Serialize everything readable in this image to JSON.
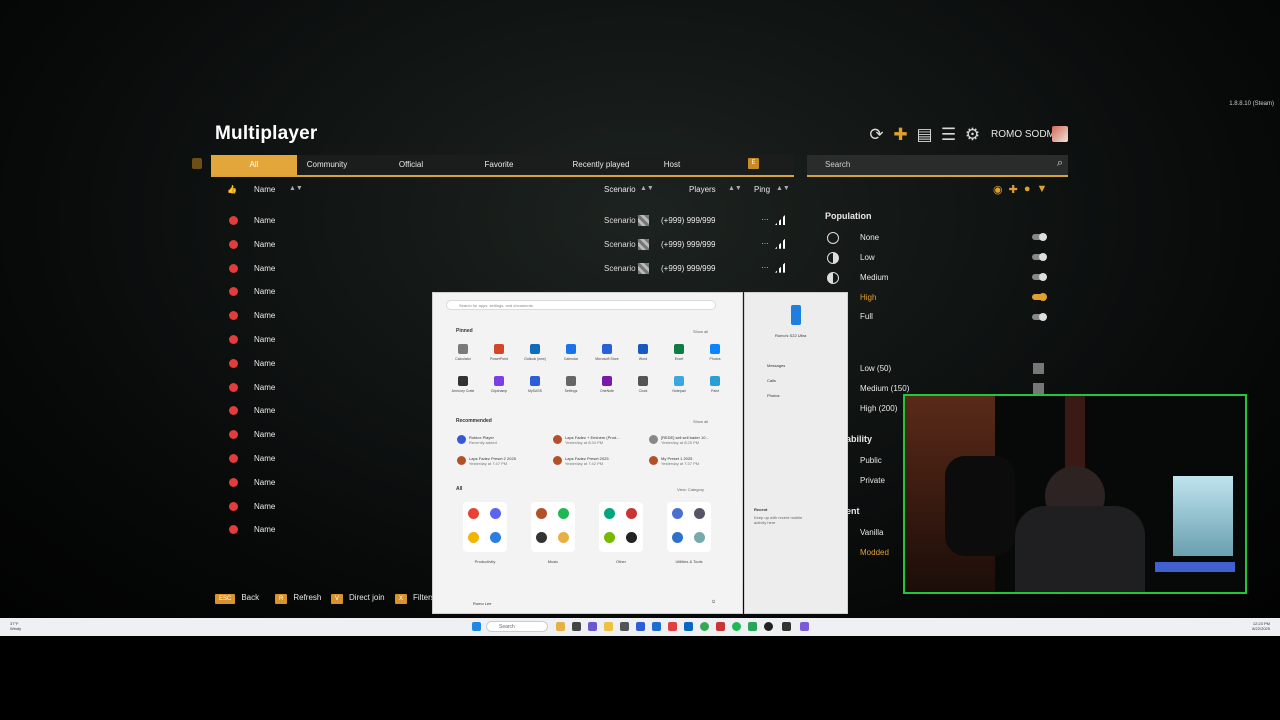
{
  "app": {
    "version": "1.8.8.10 (Steam)",
    "title": "Multiplayer",
    "username": "ROMO SODMG",
    "accent_color": "#e3a63b"
  },
  "tabs": [
    {
      "label": "All",
      "active": true
    },
    {
      "label": "Community"
    },
    {
      "label": "Official"
    },
    {
      "label": "Favorite"
    },
    {
      "label": "Recently played"
    },
    {
      "label": "Host"
    }
  ],
  "tab_extra_key": "E",
  "search": {
    "placeholder": "Search"
  },
  "columns": {
    "name": "Name",
    "scenario": "Scenario",
    "players": "Players",
    "ping": "Ping"
  },
  "servers": [
    {
      "name": "Name",
      "scenario": "Scenario",
      "players": "(+999) 999/999"
    },
    {
      "name": "Name",
      "scenario": "Scenario",
      "players": "(+999) 999/999"
    },
    {
      "name": "Name",
      "scenario": "Scenario",
      "players": "(+999) 999/999"
    },
    {
      "name": "Name"
    },
    {
      "name": "Name"
    },
    {
      "name": "Name"
    },
    {
      "name": "Name"
    },
    {
      "name": "Name"
    },
    {
      "name": "Name"
    },
    {
      "name": "Name"
    },
    {
      "name": "Name"
    },
    {
      "name": "Name"
    },
    {
      "name": "Name"
    },
    {
      "name": "Name"
    }
  ],
  "filters": {
    "population_header": "Population",
    "population": [
      "None",
      "Low",
      "Medium",
      "High",
      "Full"
    ],
    "high_selected": true,
    "capacity": [
      "Low (50)",
      "Medium (150)",
      "High (200)"
    ],
    "availability_header": "ability",
    "availability": [
      "Public",
      "Private"
    ],
    "content_header": "ent",
    "content": [
      "Vanilla",
      "Modded"
    ]
  },
  "bottom": [
    {
      "key": "ESC",
      "label": "Back"
    },
    {
      "key": "R",
      "label": "Refresh"
    },
    {
      "key": "V",
      "label": "Direct join"
    },
    {
      "key": "X",
      "label": "Filters"
    }
  ],
  "start_menu": {
    "search_placeholder": "Search for apps, settings, and documents",
    "pinned_label": "Pinned",
    "show_all": "Show all",
    "pinned_apps": [
      "Calculator",
      "PowerPoint",
      "Outlook (new)",
      "Calendar",
      "Microsoft Store",
      "Word",
      "Excel",
      "Photos",
      "Armoury Crate",
      "Clipchamp",
      "MySASS",
      "Settings",
      "OneNote",
      "Clock",
      "Notepad",
      "Paint"
    ],
    "recommended_label": "Recommended",
    "recommended": [
      {
        "title": "Roblox Player",
        "sub": "Recently added"
      },
      {
        "title": "Laps Fadez + Eminem (Prod...",
        "sub": "Yesterday at 8:34 PM"
      },
      {
        "title": "[REDE] sell sell bader 10...",
        "sub": "Yesterday at 8:25 PM"
      },
      {
        "title": "Laps Fadez Preset 2 2025",
        "sub": "Yesterday at 7:47 PM"
      },
      {
        "title": "Laps Fadez Preset 2025",
        "sub": "Yesterday at 7:42 PM"
      },
      {
        "title": "My Preset 1 2025",
        "sub": "Yesterday at 7:37 PM"
      }
    ],
    "all_label": "All",
    "view_label": "View: Category",
    "groups": [
      "Productivity",
      "Music",
      "Other",
      "Utilities & Tools"
    ],
    "user": "Romo Lee",
    "side_device": "Romo's S22 Ultra",
    "side_items": [
      "Messages",
      "Calls",
      "Photos"
    ],
    "recent_label": "Recent",
    "recent_text": "Keep up with recent mobile activity here"
  },
  "taskbar": {
    "search_placeholder": "Search",
    "weather_temp": "37°F",
    "weather_desc": "Windy",
    "time": "12:23 PM",
    "date": "8/22/2025"
  }
}
